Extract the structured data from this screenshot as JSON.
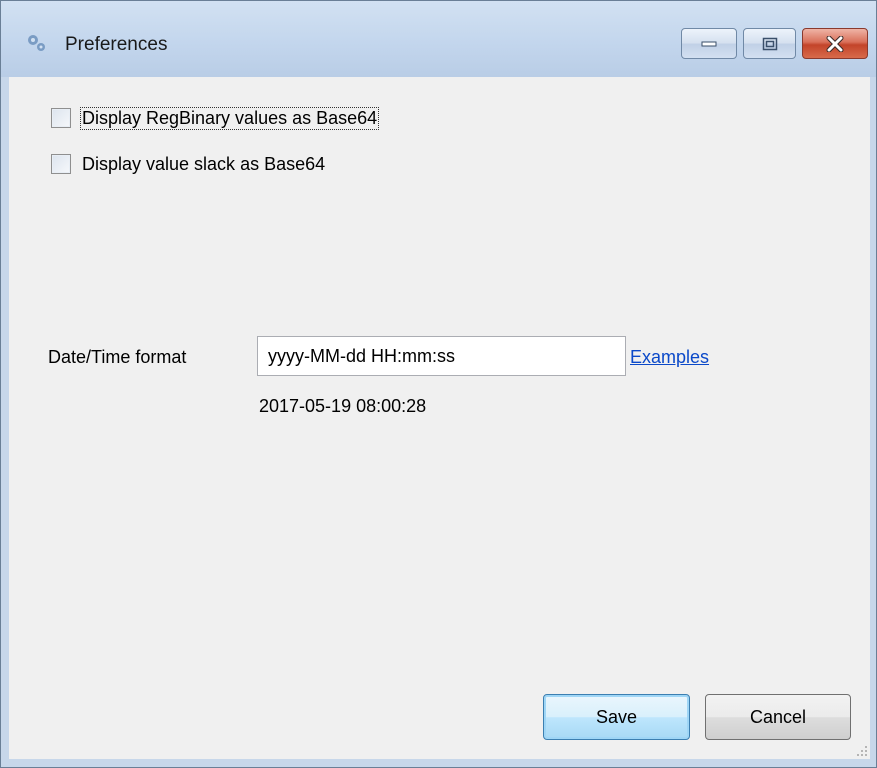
{
  "window": {
    "title": "Preferences",
    "title_icon": "gears-icon",
    "controls": [
      "minimize-icon",
      "maximize-icon",
      "close-icon"
    ]
  },
  "options": {
    "regbinary_base64": {
      "label": "Display RegBinary values as Base64",
      "checked": false
    },
    "slack_base64": {
      "label": "Display value slack as Base64",
      "checked": false
    }
  },
  "datetime": {
    "label": "Date/Time format",
    "value": "yyyy-MM-dd HH:mm:ss",
    "examples_link": "Examples",
    "preview": "2017-05-19 08:00:28"
  },
  "buttons": {
    "save": "Save",
    "cancel": "Cancel"
  },
  "colors": {
    "link": "#0b49c9",
    "close_button": "#c3442a",
    "titlebar": "#c7d7ea"
  }
}
